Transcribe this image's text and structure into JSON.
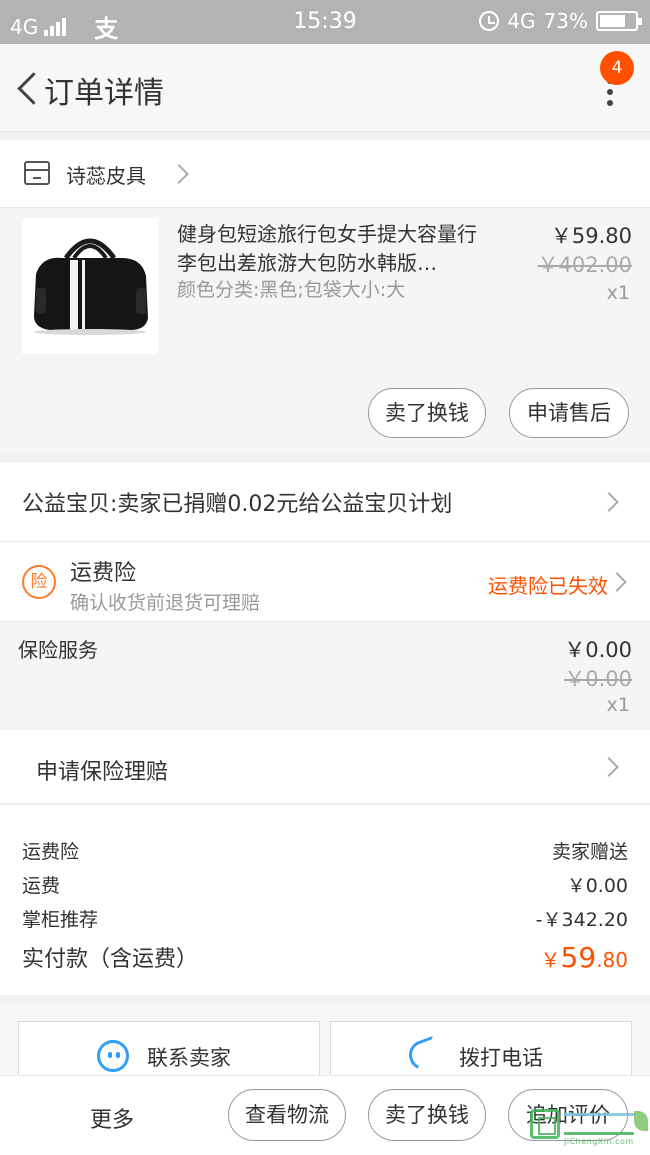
{
  "status_bar": {
    "network_left": "4G",
    "time": "15:39",
    "network_right": "4G",
    "battery": "73%",
    "battery_level": 0.73
  },
  "nav": {
    "title": "订单详情",
    "badge_count": "4"
  },
  "shop": {
    "name": "诗蕊皮具"
  },
  "product": {
    "title": "健身包短途旅行包女手提大容量行李包出差旅游大包防水韩版…",
    "spec": "颜色分类:黑色;包袋大小:大",
    "price": "￥59.80",
    "original_price": "￥402.00",
    "quantity": "x1",
    "actions": [
      "卖了换钱",
      "申请售后"
    ]
  },
  "charity": {
    "text": "公益宝贝:卖家已捐赠0.02元给公益宝贝计划"
  },
  "shipping_insurance": {
    "icon_char": "险",
    "title": "运费险",
    "subtitle": "确认收货前退货可理赔",
    "status": "运费险已失效"
  },
  "insurance_service": {
    "label": "保险服务",
    "price": "￥0.00",
    "original_price": "￥0.00",
    "quantity": "x1"
  },
  "claim": {
    "label": "申请保险理赔"
  },
  "summary": {
    "rows": [
      {
        "label": "运费险",
        "value": "卖家赠送"
      },
      {
        "label": "运费",
        "value": "￥0.00"
      },
      {
        "label": "掌柜推荐",
        "value": "-￥342.20"
      }
    ],
    "total_label": "实付款（含运费）",
    "total_currency": "￥",
    "total_int": "59",
    "total_dec": ".80"
  },
  "contact": {
    "seller": "联系卖家",
    "phone": "拨打电话"
  },
  "bottom_bar": {
    "more": "更多",
    "buttons": [
      "查看物流",
      "卖了换钱",
      "追加评价"
    ]
  },
  "watermark": {
    "url": "JiChengXin.com"
  },
  "colors": {
    "accent": "#ff5000",
    "link_blue": "#2f9ef8",
    "status_bar": "#b3b3b3"
  }
}
